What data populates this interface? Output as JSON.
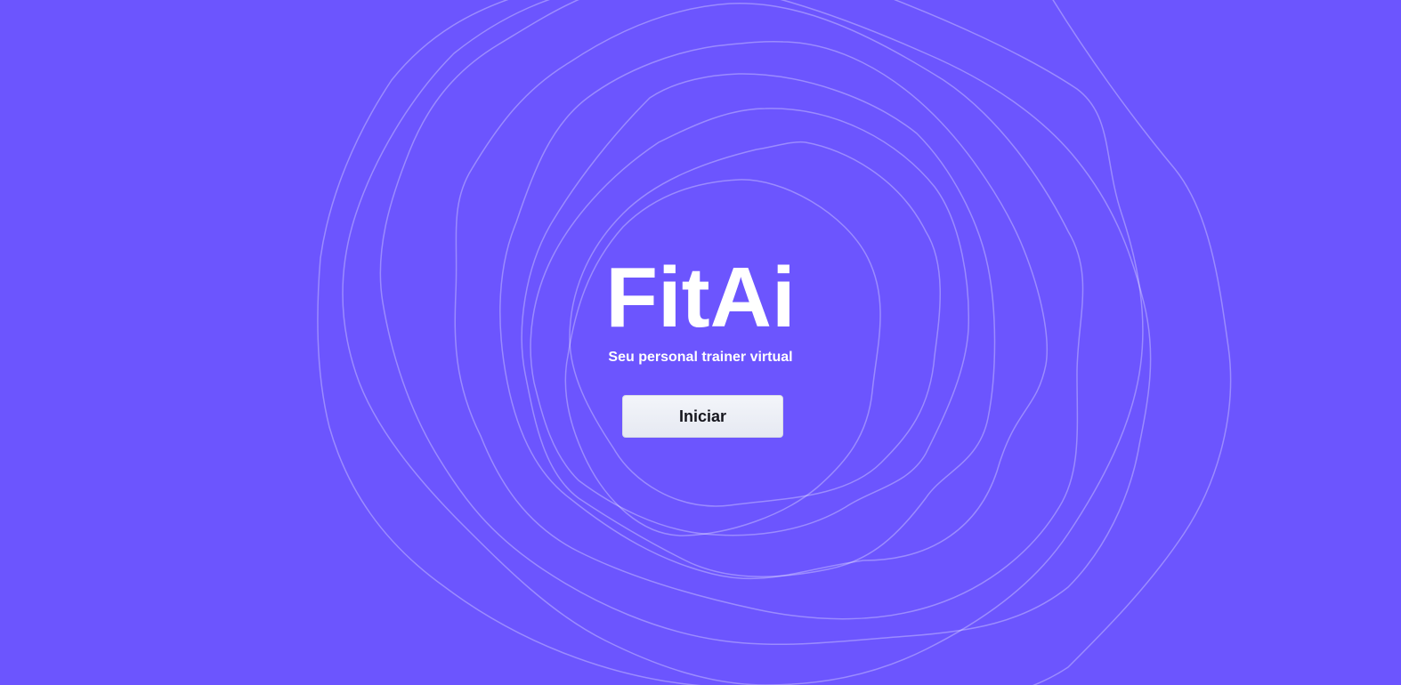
{
  "app": {
    "title": "FitAi",
    "subtitle": "Seu personal trainer virtual"
  },
  "actions": {
    "start_label": "Iniciar"
  },
  "colors": {
    "background": "#6c55fe",
    "wave_stroke": "rgba(255,255,255,0.32)",
    "button_bg": "#eceff6",
    "button_text": "#16161e",
    "title_text": "#ffffff"
  }
}
